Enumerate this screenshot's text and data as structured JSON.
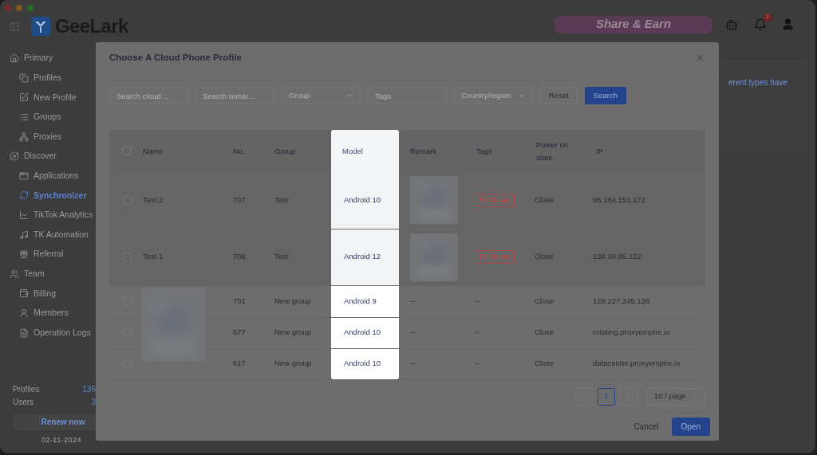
{
  "app": {
    "logo": "GeeLark",
    "banner": "Share & Earn",
    "notifications": "2"
  },
  "sidebar": {
    "sections": [
      {
        "label": "Primary",
        "children": [
          {
            "label": "Profiles",
            "selected": false
          },
          {
            "label": "New Profile",
            "selected": false
          },
          {
            "label": "Groups",
            "selected": false
          },
          {
            "label": "Proxies",
            "selected": false
          }
        ]
      },
      {
        "label": "Discover",
        "children": [
          {
            "label": "Applications",
            "selected": false
          },
          {
            "label": "Synchronizer",
            "selected": true
          },
          {
            "label": "TikTok Analytics",
            "selected": false
          },
          {
            "label": "TK Automation",
            "selected": false
          },
          {
            "label": "Referral",
            "selected": false
          }
        ]
      },
      {
        "label": "Team",
        "children": [
          {
            "label": "Billing",
            "selected": false
          },
          {
            "label": "Members",
            "selected": false
          },
          {
            "label": "Operation Logs",
            "selected": false
          }
        ]
      }
    ],
    "stats": [
      {
        "label": "Profiles",
        "value": "136"
      },
      {
        "label": "Users",
        "value": "3"
      }
    ],
    "renew": "Renew now",
    "date": "02-11-2024"
  },
  "background_text": "erent types have",
  "modal": {
    "title": "Choose A Cloud Phone Profile",
    "filters": [
      {
        "kind": "input",
        "placeholder": "Search cloud ..."
      },
      {
        "kind": "input",
        "placeholder": "Search remar..."
      },
      {
        "kind": "select",
        "placeholder": "Group"
      },
      {
        "kind": "input",
        "placeholder": "Tags"
      },
      {
        "kind": "select",
        "placeholder": "Country/region"
      }
    ],
    "reset": "Reset",
    "search": "Search",
    "columns": [
      "Name",
      "No.",
      "Group",
      "Model",
      "Remark",
      "Tags",
      "Power on state",
      "IP"
    ],
    "header_checked": false,
    "rows": [
      {
        "checked": false,
        "name": "Test 2",
        "no": "707",
        "group": "Test",
        "model": "Android 10",
        "tag": "TikTok acc",
        "power": "Close",
        "ip": "95.164.151.172",
        "highlighted": true
      },
      {
        "checked": false,
        "name": "Test 1",
        "no": "706",
        "group": "Test",
        "model": "Android 12",
        "tag": "TikTok acc",
        "power": "Close",
        "ip": "138.36.95.122",
        "highlighted": true
      },
      {
        "checked": false,
        "no": "701",
        "group": "New group",
        "model": "Android 9",
        "remark": "--",
        "tag_empty": "--",
        "power": "Close",
        "ip": "129.227.245.128",
        "highlighted": false
      },
      {
        "checked": false,
        "no": "677",
        "group": "New group",
        "model": "Android 10",
        "remark": "--",
        "tag_empty": "--",
        "power": "Close",
        "ip": "rotating.proxyempire.io",
        "highlighted": false
      },
      {
        "checked": false,
        "no": "617",
        "group": "New group",
        "model": "Android 10",
        "remark": "--",
        "tag_empty": "--",
        "power": "Close",
        "ip": "datacenter.proxyempire.io",
        "highlighted": false
      }
    ],
    "pages": [
      {
        "label": "1",
        "selected": true
      }
    ],
    "page_size": "10 / page",
    "cancel": "Cancel",
    "open": "Open"
  }
}
